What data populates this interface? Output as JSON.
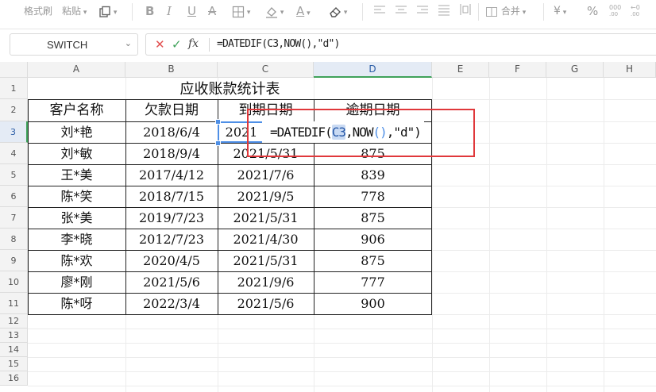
{
  "toolbar": {
    "format_painter": "格式刷",
    "paste": "粘贴",
    "merge": "合并",
    "currency": "¥",
    "percent": "%"
  },
  "formula_bar": {
    "name_box": "SWITCH",
    "formula": "=DATEDIF(C3,NOW(),\"d\")"
  },
  "columns": [
    "A",
    "B",
    "C",
    "D",
    "E",
    "F",
    "G",
    "H"
  ],
  "rows": [
    "1",
    "2",
    "3",
    "4",
    "5",
    "6",
    "7",
    "8",
    "9",
    "10",
    "11",
    "12",
    "13",
    "14",
    "15",
    "16"
  ],
  "sheet": {
    "title": "应收账款统计表",
    "headers": [
      "客户名称",
      "欠款日期",
      "到期日期",
      "逾期日期"
    ],
    "records": [
      {
        "name": "刘*艳",
        "debt_date": "2018/6/4",
        "due_date": "2021",
        "overdue": ""
      },
      {
        "name": "刘*敏",
        "debt_date": "2018/9/4",
        "due_date": "2021/5/31",
        "overdue": "875"
      },
      {
        "name": "王*美",
        "debt_date": "2017/4/12",
        "due_date": "2021/7/6",
        "overdue": "839"
      },
      {
        "name": "陈*笑",
        "debt_date": "2018/7/15",
        "due_date": "2021/9/5",
        "overdue": "778"
      },
      {
        "name": "张*美",
        "debt_date": "2019/7/23",
        "due_date": "2021/5/31",
        "overdue": "875"
      },
      {
        "name": "李*晓",
        "debt_date": "2012/7/23",
        "due_date": "2021/4/30",
        "overdue": "906"
      },
      {
        "name": "陈*欢",
        "debt_date": "2020/4/5",
        "due_date": "2021/5/31",
        "overdue": "875"
      },
      {
        "name": "廖*刚",
        "debt_date": "2021/5/6",
        "due_date": "2021/9/6",
        "overdue": "777"
      },
      {
        "name": "陈*呀",
        "debt_date": "2022/3/4",
        "due_date": "2021/5/6",
        "overdue": "900"
      }
    ]
  },
  "editing": {
    "prefix": "=DATEDIF(",
    "ref": "C3",
    "middle": ",NOW",
    "parens": "()",
    "suffix": ",\"d\")"
  },
  "colors": {
    "selection": "#4e8fe6",
    "annotation_box": "#e0383b",
    "active_header": "#3fa25a"
  }
}
